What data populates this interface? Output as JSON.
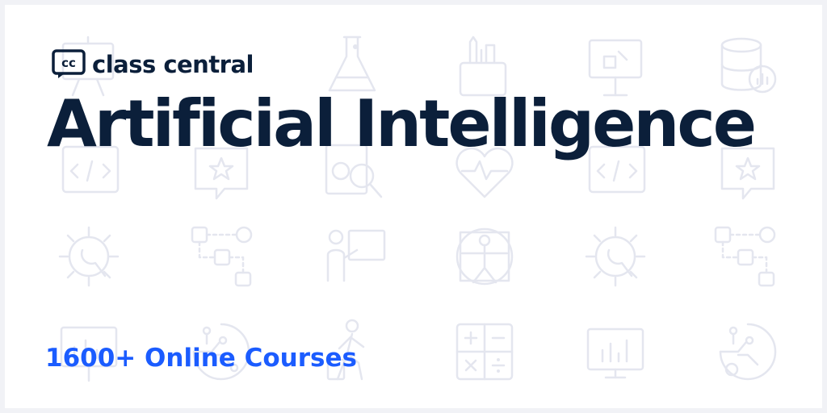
{
  "brand": {
    "logo_mark_text": "cc",
    "name": "class central"
  },
  "headline": "Artificial Intelligence",
  "subline": "1600+ Online Courses",
  "colors": {
    "title": "#0b1f3a",
    "accent": "#1b5cff",
    "background": "#ffffff",
    "frame": "#f1f2f6",
    "pattern": "#e4e6ef"
  },
  "background_icons": [
    "presentation-board-icon",
    "flask-icon",
    "pen-cup-icon",
    "presentation-easel-icon",
    "database-chart-icon",
    "code-window-icon",
    "star-bookmark-icon",
    "chart-magnifier-icon",
    "heartbeat-icon",
    "code-window-icon",
    "star-bookmark-icon",
    "gear-brain-icon",
    "flowchart-icon",
    "teacher-board-icon",
    "vitruvian-man-icon",
    "gear-brain-icon",
    "flowchart-icon",
    "presentation-board-icon",
    "circuit-globe-icon",
    "walking-person-icon",
    "calculator-icon",
    "bar-chart-board-icon",
    "circuit-globe-icon"
  ]
}
